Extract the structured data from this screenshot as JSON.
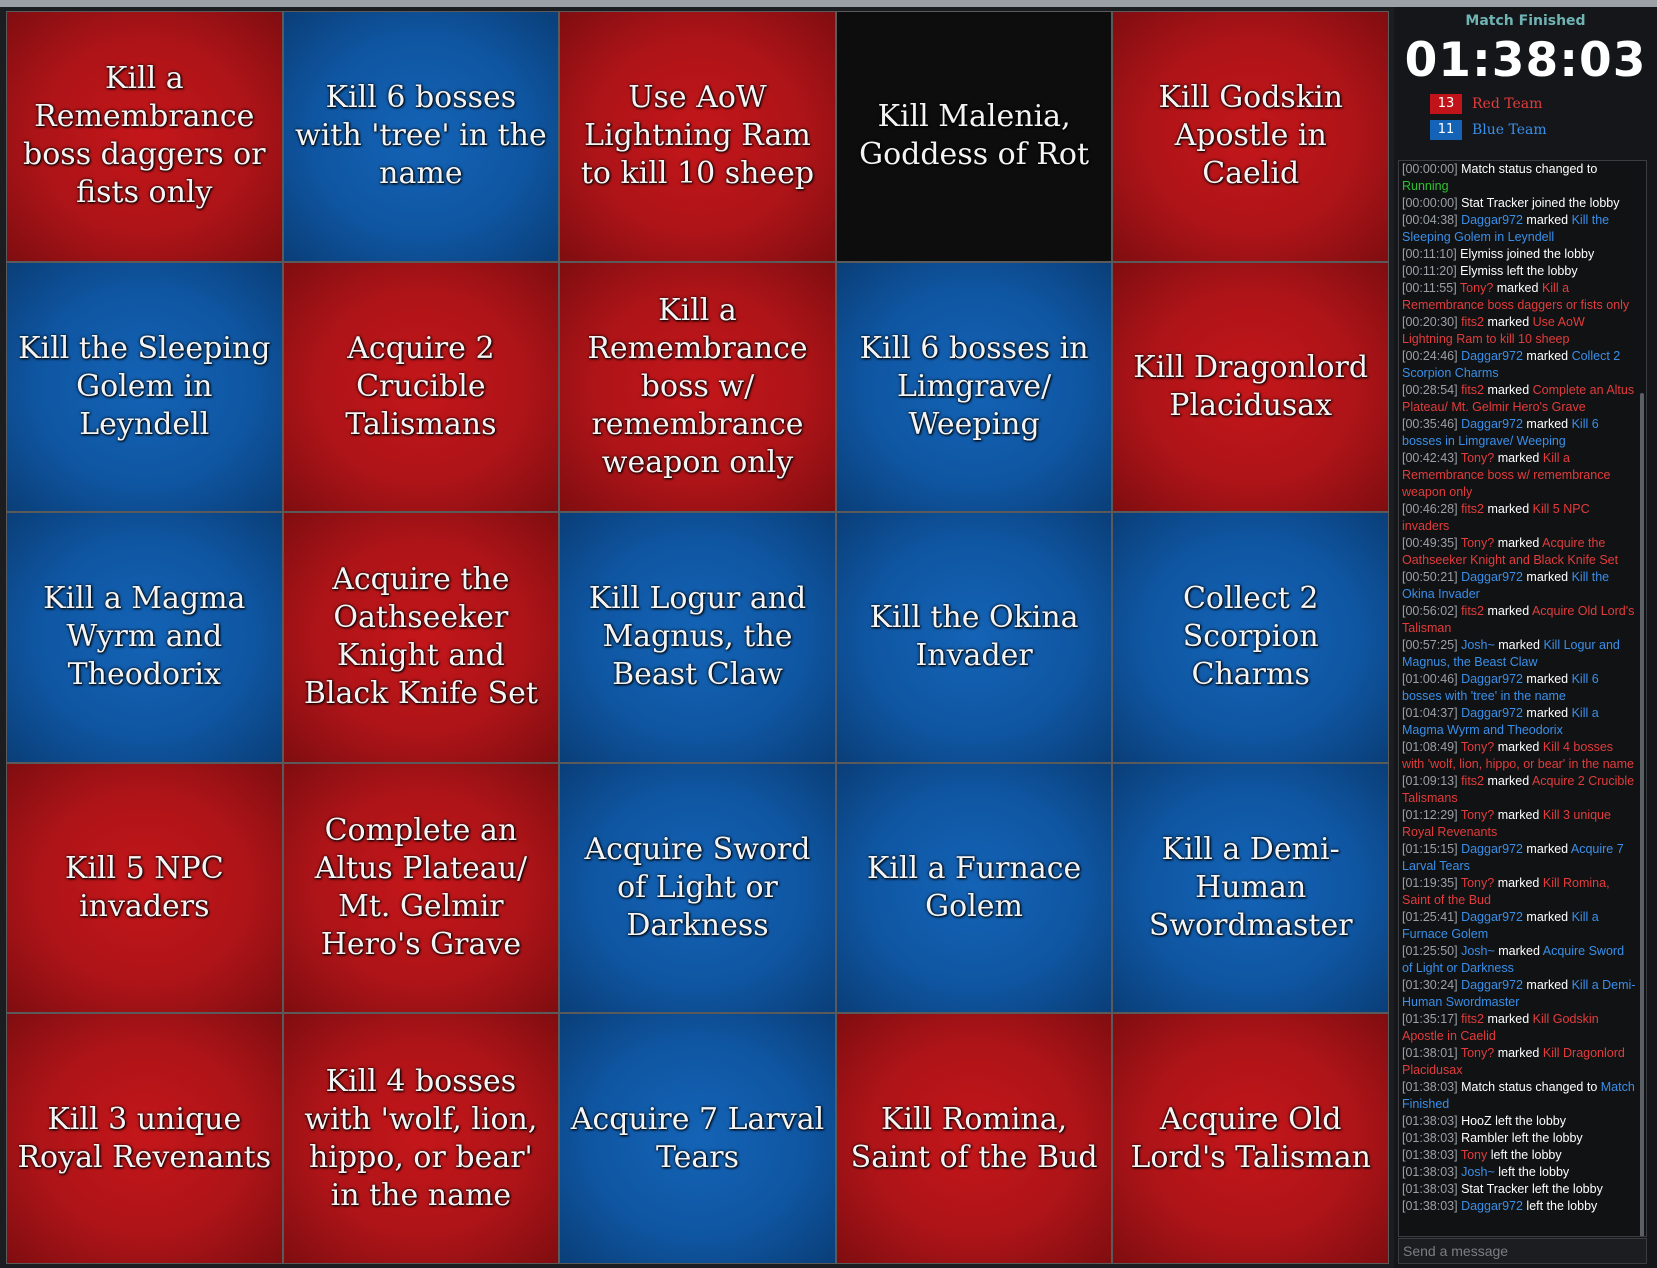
{
  "board": {
    "cells": [
      {
        "text": "Kill a Remembrance boss daggers or fists only",
        "color": "red"
      },
      {
        "text": "Kill 6 bosses with 'tree' in the name",
        "color": "blue"
      },
      {
        "text": "Use AoW Lightning Ram to kill 10 sheep",
        "color": "red"
      },
      {
        "text": "Kill Malenia, Goddess of Rot",
        "color": "black"
      },
      {
        "text": "Kill Godskin Apostle in Caelid",
        "color": "red"
      },
      {
        "text": "Kill the Sleeping Golem in Leyndell",
        "color": "blue"
      },
      {
        "text": "Acquire 2 Crucible Talismans",
        "color": "red"
      },
      {
        "text": "Kill a Remembrance boss w/ remembrance weapon only",
        "color": "red"
      },
      {
        "text": "Kill 6 bosses in Limgrave/ Weeping",
        "color": "blue"
      },
      {
        "text": "Kill Dragonlord Placidusax",
        "color": "red"
      },
      {
        "text": "Kill a Magma Wyrm and Theodorix",
        "color": "blue"
      },
      {
        "text": "Acquire the Oathseeker Knight and Black Knife Set",
        "color": "red"
      },
      {
        "text": "Kill Logur and Magnus, the Beast Claw",
        "color": "blue"
      },
      {
        "text": "Kill the Okina Invader",
        "color": "blue"
      },
      {
        "text": "Collect 2 Scorpion Charms",
        "color": "blue"
      },
      {
        "text": "Kill 5 NPC invaders",
        "color": "red"
      },
      {
        "text": "Complete an Altus Plateau/ Mt. Gelmir Hero's Grave",
        "color": "red"
      },
      {
        "text": "Acquire Sword of Light or Darkness",
        "color": "blue"
      },
      {
        "text": "Kill a Furnace Golem",
        "color": "blue"
      },
      {
        "text": "Kill a Demi-Human Swordmaster",
        "color": "blue"
      },
      {
        "text": "Kill 3 unique Royal Revenants",
        "color": "red"
      },
      {
        "text": "Kill 4 bosses with 'wolf, lion, hippo, or bear' in the name",
        "color": "red"
      },
      {
        "text": "Acquire 7 Larval Tears",
        "color": "blue"
      },
      {
        "text": "Kill Romina, Saint of the Bud",
        "color": "red"
      },
      {
        "text": "Acquire Old Lord's Talisman",
        "color": "red"
      }
    ]
  },
  "sidebar": {
    "status": "Match Finished",
    "timer": "01:38:03",
    "teams": {
      "red": {
        "score": "13",
        "name": "Red Team",
        "color": "#c1141a"
      },
      "blue": {
        "score": "11",
        "name": "Blue Team",
        "color": "#1463b6"
      }
    }
  },
  "chat": {
    "messages": [
      {
        "ts": "[00:00:00]",
        "parts": [
          {
            "t": " Match status changed to "
          },
          {
            "t": "Running",
            "c": "u-green"
          }
        ]
      },
      {
        "ts": "[00:00:00]",
        "parts": [
          {
            "t": " Stat Tracker joined the lobby"
          }
        ]
      },
      {
        "ts": "[00:04:38]",
        "parts": [
          {
            "t": " Daggar972",
            "c": "u-blue"
          },
          {
            "t": " marked "
          },
          {
            "t": "Kill the Sleeping Golem in Leyndell",
            "c": "t-blue"
          }
        ]
      },
      {
        "ts": "[00:11:10]",
        "parts": [
          {
            "t": " Elymiss joined the lobby"
          }
        ]
      },
      {
        "ts": "[00:11:20]",
        "parts": [
          {
            "t": " Elymiss left the lobby"
          }
        ]
      },
      {
        "ts": "[00:11:55]",
        "parts": [
          {
            "t": " Tony?",
            "c": "u-red"
          },
          {
            "t": " marked "
          },
          {
            "t": "Kill a Remembrance boss daggers or fists only",
            "c": "t-red"
          }
        ]
      },
      {
        "ts": "[00:20:30]",
        "parts": [
          {
            "t": " fits2",
            "c": "u-red"
          },
          {
            "t": " marked "
          },
          {
            "t": "Use AoW Lightning Ram to kill 10 sheep",
            "c": "t-red"
          }
        ]
      },
      {
        "ts": "[00:24:46]",
        "parts": [
          {
            "t": " Daggar972",
            "c": "u-blue"
          },
          {
            "t": " marked "
          },
          {
            "t": "Collect 2 Scorpion Charms",
            "c": "t-blue"
          }
        ]
      },
      {
        "ts": "[00:28:54]",
        "parts": [
          {
            "t": " fits2",
            "c": "u-red"
          },
          {
            "t": " marked "
          },
          {
            "t": "Complete an Altus Plateau/ Mt. Gelmir Hero's Grave",
            "c": "t-red"
          }
        ]
      },
      {
        "ts": "[00:35:46]",
        "parts": [
          {
            "t": " Daggar972",
            "c": "u-blue"
          },
          {
            "t": " marked "
          },
          {
            "t": "Kill 6 bosses in Limgrave/ Weeping",
            "c": "t-blue"
          }
        ]
      },
      {
        "ts": "[00:42:43]",
        "parts": [
          {
            "t": " Tony?",
            "c": "u-red"
          },
          {
            "t": " marked "
          },
          {
            "t": "Kill a Remembrance boss w/ remembrance weapon only",
            "c": "t-red"
          }
        ]
      },
      {
        "ts": "[00:46:28]",
        "parts": [
          {
            "t": " fits2",
            "c": "u-red"
          },
          {
            "t": " marked "
          },
          {
            "t": "Kill 5 NPC invaders",
            "c": "t-red"
          }
        ]
      },
      {
        "ts": "[00:49:35]",
        "parts": [
          {
            "t": " Tony?",
            "c": "u-red"
          },
          {
            "t": " marked "
          },
          {
            "t": "Acquire the Oathseeker Knight and Black Knife Set",
            "c": "t-red"
          }
        ]
      },
      {
        "ts": "[00:50:21]",
        "parts": [
          {
            "t": " Daggar972",
            "c": "u-blue"
          },
          {
            "t": " marked "
          },
          {
            "t": "Kill the Okina Invader",
            "c": "t-blue"
          }
        ]
      },
      {
        "ts": "[00:56:02]",
        "parts": [
          {
            "t": " fits2",
            "c": "u-red"
          },
          {
            "t": " marked "
          },
          {
            "t": "Acquire Old Lord's Talisman",
            "c": "t-red"
          }
        ]
      },
      {
        "ts": "[00:57:25]",
        "parts": [
          {
            "t": " Josh~",
            "c": "u-blue"
          },
          {
            "t": " marked "
          },
          {
            "t": "Kill Logur and Magnus, the Beast Claw",
            "c": "t-blue"
          }
        ]
      },
      {
        "ts": "[01:00:46]",
        "parts": [
          {
            "t": " Daggar972",
            "c": "u-blue"
          },
          {
            "t": " marked "
          },
          {
            "t": "Kill 6 bosses with 'tree' in the name",
            "c": "t-blue"
          }
        ]
      },
      {
        "ts": "[01:04:37]",
        "parts": [
          {
            "t": " Daggar972",
            "c": "u-blue"
          },
          {
            "t": " marked "
          },
          {
            "t": "Kill a Magma Wyrm and Theodorix",
            "c": "t-blue"
          }
        ]
      },
      {
        "ts": "[01:08:49]",
        "parts": [
          {
            "t": " Tony?",
            "c": "u-red"
          },
          {
            "t": " marked "
          },
          {
            "t": "Kill 4 bosses with 'wolf, lion, hippo, or bear' in the name",
            "c": "t-red"
          }
        ]
      },
      {
        "ts": "[01:09:13]",
        "parts": [
          {
            "t": " fits2",
            "c": "u-red"
          },
          {
            "t": " marked "
          },
          {
            "t": "Acquire 2 Crucible Talismans",
            "c": "t-red"
          }
        ]
      },
      {
        "ts": "[01:12:29]",
        "parts": [
          {
            "t": " Tony?",
            "c": "u-red"
          },
          {
            "t": " marked "
          },
          {
            "t": "Kill 3 unique Royal Revenants",
            "c": "t-red"
          }
        ]
      },
      {
        "ts": "[01:15:15]",
        "parts": [
          {
            "t": " Daggar972",
            "c": "u-blue"
          },
          {
            "t": " marked "
          },
          {
            "t": "Acquire 7 Larval Tears",
            "c": "t-blue"
          }
        ]
      },
      {
        "ts": "[01:19:35]",
        "parts": [
          {
            "t": " Tony?",
            "c": "u-red"
          },
          {
            "t": " marked "
          },
          {
            "t": "Kill Romina, Saint of the Bud",
            "c": "t-red"
          }
        ]
      },
      {
        "ts": "[01:25:41]",
        "parts": [
          {
            "t": " Daggar972",
            "c": "u-blue"
          },
          {
            "t": " marked "
          },
          {
            "t": "Kill a Furnace Golem",
            "c": "t-blue"
          }
        ]
      },
      {
        "ts": "[01:25:50]",
        "parts": [
          {
            "t": " Josh~",
            "c": "u-blue"
          },
          {
            "t": " marked "
          },
          {
            "t": "Acquire Sword of Light or Darkness",
            "c": "t-blue"
          }
        ]
      },
      {
        "ts": "[01:30:24]",
        "parts": [
          {
            "t": " Daggar972",
            "c": "u-blue"
          },
          {
            "t": " marked "
          },
          {
            "t": "Kill a Demi-Human Swordmaster",
            "c": "t-blue"
          }
        ]
      },
      {
        "ts": "[01:35:17]",
        "parts": [
          {
            "t": " fits2",
            "c": "u-red"
          },
          {
            "t": " marked "
          },
          {
            "t": "Kill Godskin Apostle in Caelid",
            "c": "t-red"
          }
        ]
      },
      {
        "ts": "[01:38:01]",
        "parts": [
          {
            "t": " Tony?",
            "c": "u-red"
          },
          {
            "t": " marked "
          },
          {
            "t": "Kill Dragonlord Placidusax",
            "c": "t-red"
          }
        ]
      },
      {
        "ts": "[01:38:03]",
        "parts": [
          {
            "t": " Match status changed to "
          },
          {
            "t": "Match Finished",
            "c": "t-blue"
          }
        ]
      },
      {
        "ts": "[01:38:03]",
        "parts": [
          {
            "t": " HooZ left the lobby"
          }
        ]
      },
      {
        "ts": "[01:38:03]",
        "parts": [
          {
            "t": " Rambler left the lobby"
          }
        ]
      },
      {
        "ts": "[01:38:03]",
        "parts": [
          {
            "t": " Tony",
            "c": "u-red"
          },
          {
            "t": " left the lobby"
          }
        ]
      },
      {
        "ts": "[01:38:03]",
        "parts": [
          {
            "t": " Josh~",
            "c": "u-blue"
          },
          {
            "t": " left the lobby"
          }
        ]
      },
      {
        "ts": "[01:38:03]",
        "parts": [
          {
            "t": " Stat Tracker left the lobby"
          }
        ]
      },
      {
        "ts": "[01:38:03]",
        "parts": [
          {
            "t": " Daggar972",
            "c": "u-blue"
          },
          {
            "t": " left the lobby"
          }
        ]
      }
    ],
    "send_placeholder": "Send a message"
  }
}
